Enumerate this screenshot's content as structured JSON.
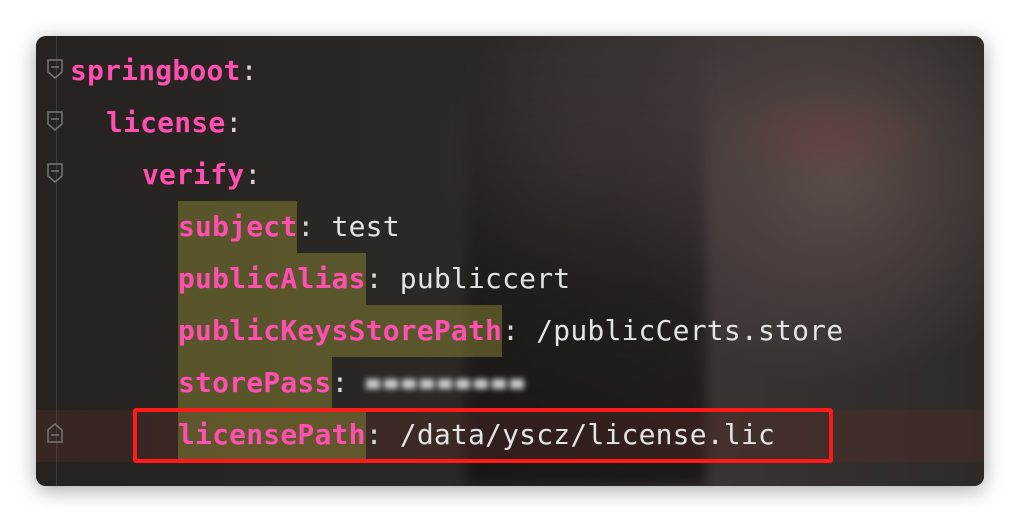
{
  "editor": {
    "lines": [
      {
        "key": "springboot",
        "colon": ":",
        "value": ""
      },
      {
        "key": "license",
        "colon": ":",
        "value": ""
      },
      {
        "key": "verify",
        "colon": ":",
        "value": ""
      },
      {
        "key": "subject",
        "colon": ":",
        "value": " test"
      },
      {
        "key": "publicAlias",
        "colon": ":",
        "value": " publiccert"
      },
      {
        "key": "publicKeysStorePath",
        "colon": ":",
        "value": " /publicCerts.store"
      },
      {
        "key": "storePass",
        "colon": ":",
        "value": "",
        "obscured": true
      },
      {
        "key": "licensePath",
        "colon": ":",
        "value": " /data/yscz/license.lic"
      }
    ],
    "highlight_color": "#ff1a1a",
    "key_color": "#ff4fb0"
  }
}
